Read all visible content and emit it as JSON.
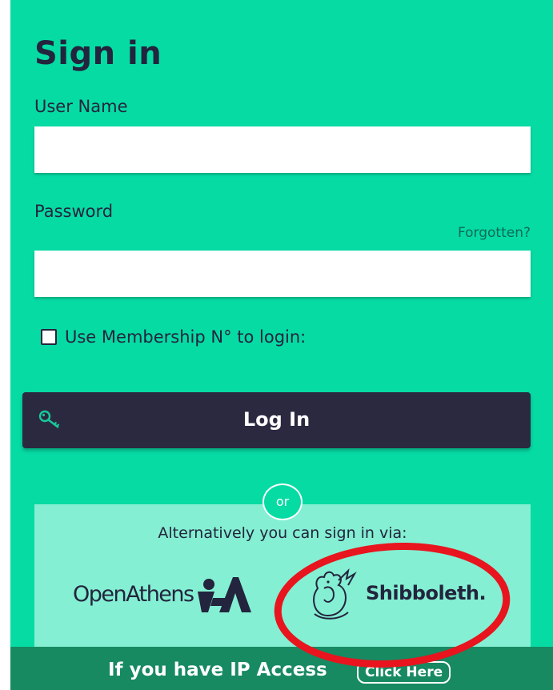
{
  "signin": {
    "title": "Sign in",
    "username_label": "User Name",
    "username_value": "",
    "password_label": "Password",
    "password_value": "",
    "forgot_link": "Forgotten?",
    "membership_label": "Use Membership N° to login:",
    "membership_checked": false,
    "login_button": "Log In"
  },
  "alternatives": {
    "or_label": "or",
    "intro": "Alternatively you can sign in via:",
    "openathens_label": "OpenAthens",
    "shibboleth_label": "Shibboleth."
  },
  "ip_access": {
    "text": "If you have IP Access",
    "button": "Click Here"
  },
  "colors": {
    "panel_bg": "#06dba4",
    "button_bg": "#2b2940",
    "alt_bg": "#84efd2",
    "ip_bar_bg": "#178a62",
    "annotation_oval": "#e8141e"
  }
}
